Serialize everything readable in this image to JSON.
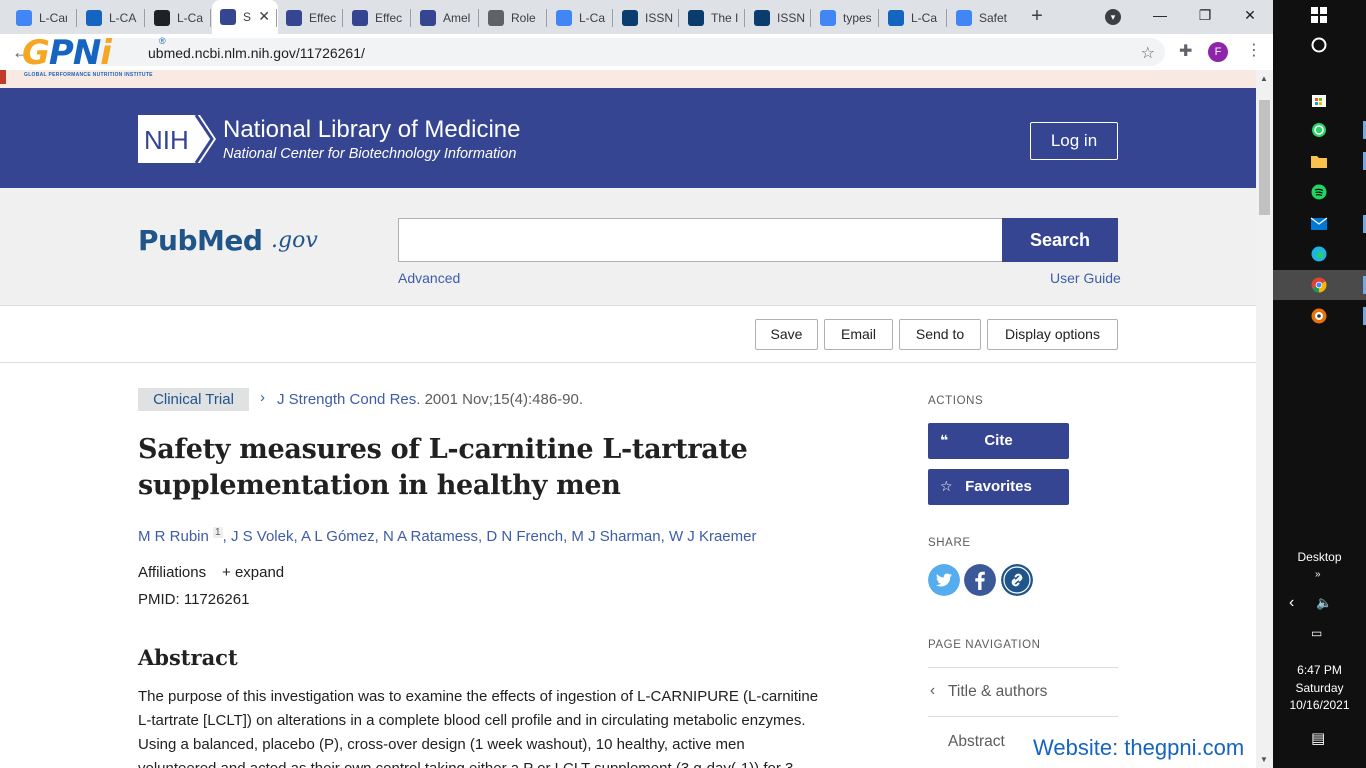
{
  "browser": {
    "tabs": [
      {
        "label": "L-Car",
        "favicon": "docs-icon",
        "color": "#4285f4"
      },
      {
        "label": "L-CA",
        "favicon": "webmd-icon",
        "color": "#1565c0"
      },
      {
        "label": "L-Ca",
        "favicon": "h-icon",
        "color": "#202124"
      },
      {
        "label": "S",
        "favicon": "ncbi-icon",
        "color": "#364592",
        "active": true
      },
      {
        "label": "Effec",
        "favicon": "ncbi-icon",
        "color": "#364592"
      },
      {
        "label": "Effec",
        "favicon": "ncbi-icon",
        "color": "#364592"
      },
      {
        "label": "Amel",
        "favicon": "ncbi-icon",
        "color": "#364592"
      },
      {
        "label": "Role",
        "favicon": "dna-icon",
        "color": "#5f6368"
      },
      {
        "label": "L-Ca",
        "favicon": "google-icon",
        "color": "#4285f4"
      },
      {
        "label": "ISSN",
        "favicon": "jissn-icon",
        "color": "#0b3c6e"
      },
      {
        "label": "The I",
        "favicon": "jissn-icon",
        "color": "#0b3c6e"
      },
      {
        "label": "ISSN",
        "favicon": "jissn-icon",
        "color": "#0b3c6e"
      },
      {
        "label": "types",
        "favicon": "google-icon",
        "color": "#4285f4"
      },
      {
        "label": "L-Ca",
        "favicon": "site-icon",
        "color": "#1565c0"
      },
      {
        "label": "Safet",
        "favicon": "google-icon",
        "color": "#4285f4"
      }
    ],
    "url": "ubmed.ncbi.nlm.nih.gov/11726261/",
    "profile_initial": "F"
  },
  "overlay": {
    "logo_text_g": "G",
    "logo_text_pn": "PN",
    "logo_text_i": "i",
    "logo_reg": "®",
    "logo_sub": "GLOBAL PERFORMANCE NUTRITION INSTITUTE",
    "website": "Website: thegpni.com"
  },
  "header": {
    "logo": "NIH",
    "title": "National Library of Medicine",
    "subtitle": "National Center for Biotechnology Information",
    "login": "Log in"
  },
  "search": {
    "logo_pub": "PubMed",
    "logo_gov": ".gov",
    "value": "",
    "button": "Search",
    "advanced": "Advanced",
    "user_guide": "User Guide"
  },
  "actions_bar": {
    "save": "Save",
    "email": "Email",
    "send_to": "Send to",
    "display_options": "Display options"
  },
  "article": {
    "pub_type": "Clinical Trial",
    "journal": "J Strength Cond Res.",
    "citation": " 2001 Nov;15(4):486-90.",
    "title": "Safety measures of L-carnitine L-tartrate supplementation in healthy men",
    "authors": [
      {
        "name": "M R Rubin",
        "sup": "1"
      },
      {
        "name": "J S Volek"
      },
      {
        "name": "A L Gómez"
      },
      {
        "name": "N A Ratamess"
      },
      {
        "name": "D N French"
      },
      {
        "name": "M J Sharman"
      },
      {
        "name": "W J Kraemer"
      }
    ],
    "affiliations_label": "Affiliations",
    "expand_label": "expand",
    "pmid": "PMID: 11726261",
    "abstract_heading": "Abstract",
    "abstract_lines": [
      "The purpose of this investigation was to examine the effects of ingestion of L-CARNIPURE (L-carnitine",
      "L-tartrate [LCLT]) on alterations in a complete blood cell profile and in circulating metabolic enzymes.",
      "Using a balanced, placebo (P), cross-over design (1 week washout), 10 healthy, active men",
      "volunteered and acted as their own control taking either a P or LCLT supplement (3 g·day(-1)) for 3"
    ]
  },
  "sidebar": {
    "actions_label": "ACTIONS",
    "cite": "Cite",
    "favorites": "Favorites",
    "share_label": "SHARE",
    "page_nav_label": "PAGE NAVIGATION",
    "nav_items": [
      "Title & authors",
      "Abstract"
    ]
  },
  "taskbar": {
    "desktop_label": "Desktop",
    "time": "6:47 PM",
    "day": "Saturday",
    "date": "10/16/2021"
  }
}
